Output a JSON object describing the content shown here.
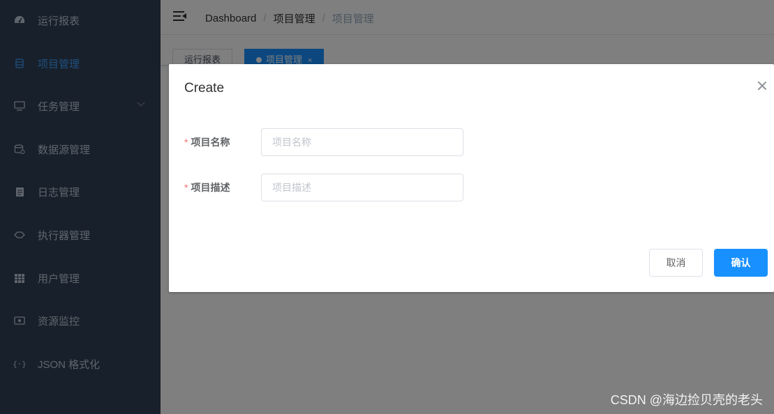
{
  "sidebar": {
    "items": [
      {
        "label": "运行报表",
        "icon": "dashboard-icon",
        "active": false
      },
      {
        "label": "项目管理",
        "icon": "project-icon",
        "active": true
      },
      {
        "label": "任务管理",
        "icon": "monitor-icon",
        "active": false,
        "has_submenu": true
      },
      {
        "label": "数据源管理",
        "icon": "database-icon",
        "active": false
      },
      {
        "label": "日志管理",
        "icon": "document-icon",
        "active": false
      },
      {
        "label": "执行器管理",
        "icon": "executor-icon",
        "active": false
      },
      {
        "label": "用户管理",
        "icon": "table-icon",
        "active": false
      },
      {
        "label": "资源监控",
        "icon": "monitor-gear-icon",
        "active": false
      },
      {
        "label": "JSON 格式化",
        "icon": "braces-icon",
        "active": false
      }
    ]
  },
  "navbar": {
    "breadcrumb": [
      "Dashboard",
      "项目管理",
      "项目管理"
    ]
  },
  "tags": [
    {
      "label": "运行报表",
      "active": false
    },
    {
      "label": "项目管理",
      "active": true,
      "close": "×"
    }
  ],
  "dialog": {
    "title": "Create",
    "fields": [
      {
        "label": "项目名称",
        "required": true,
        "placeholder": "项目名称",
        "value": ""
      },
      {
        "label": "项目描述",
        "required": true,
        "placeholder": "项目描述",
        "value": ""
      }
    ],
    "required_mark": "*",
    "cancel_label": "取消",
    "confirm_label": "确认"
  },
  "watermark": "CSDN @海边捡贝壳的老头",
  "colors": {
    "sidebar_bg": "#304156",
    "sidebar_text": "#bfcbd9",
    "accent": "#1890ff",
    "active_menu": "#409eff",
    "required": "#f56c6c"
  }
}
